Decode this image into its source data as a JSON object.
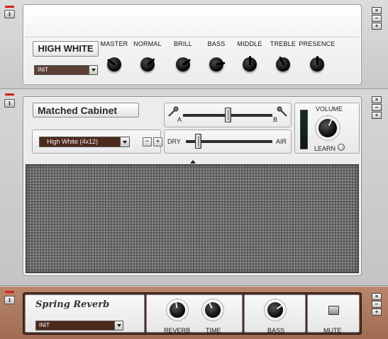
{
  "amp": {
    "power_label": "I",
    "side_buttons": [
      "×",
      "−",
      "+"
    ],
    "name": "HIGH WHITE",
    "preset": "INIT",
    "knobs": [
      {
        "label": "MASTER",
        "angle": -55
      },
      {
        "label": "NORMAL",
        "angle": 50
      },
      {
        "label": "BRILL",
        "angle": 55
      },
      {
        "label": "BASS",
        "angle": 80
      },
      {
        "label": "MIDDLE",
        "angle": 0
      },
      {
        "label": "TREBLE",
        "angle": -25
      },
      {
        "label": "PRESENCE",
        "angle": 0
      }
    ]
  },
  "cabinet": {
    "power_label": "I",
    "side_buttons": [
      "×",
      "−",
      "+"
    ],
    "name": "Matched Cabinet",
    "preset": "High White (4x12)",
    "prev_label": "−",
    "next_label": "+",
    "mic_a_label": "A",
    "mic_b_label": "B",
    "mic_position": 0.51,
    "dry_label": "DRY",
    "air_label": "AIR",
    "air_amount": 0.15,
    "volume_label": "VOLUME",
    "learn_label": "LEARN"
  },
  "reverb": {
    "power_label": "I",
    "side_buttons": [
      "×",
      "−",
      "+"
    ],
    "name": "Spring Reverb",
    "preset": "INIT",
    "reverb_label": "REVERB",
    "time_label": "TIME",
    "bass_label": "BASS",
    "mute_label": "MUTE"
  }
}
